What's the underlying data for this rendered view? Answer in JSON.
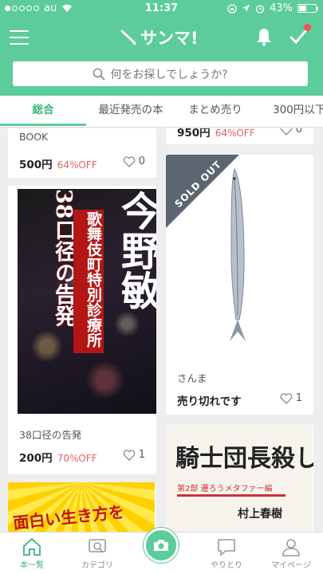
{
  "status_bar": {
    "carrier": "au",
    "time": "11:37",
    "battery": "43%",
    "battery_level": 0.43
  },
  "header": {
    "app_name": "サンマ!",
    "notification_dot": true
  },
  "search": {
    "placeholder": "何をお探しでしょうか?"
  },
  "tabs": [
    {
      "label": "総合",
      "active": true
    },
    {
      "label": "最近発売の本",
      "active": false
    },
    {
      "label": "まとめ売り",
      "active": false
    },
    {
      "label": "300円以下",
      "active": false
    }
  ],
  "items": {
    "golf": {
      "title": "女性のためのゴルフスタートBOOK",
      "price": "500円",
      "off": "64%OFF",
      "likes": "0"
    },
    "prev_right": {
      "price": "950円",
      "off": "64%OFF",
      "likes": "0"
    },
    "kon": {
      "cover_title": "38口径の告発",
      "cover_subtitle": "歌舞伎町特別診療所",
      "cover_author": "今野敏",
      "title": "38口径の告発",
      "price": "200円",
      "off": "70%OFF",
      "likes": "1"
    },
    "sanma": {
      "badge": "SOLD OUT",
      "title": "さんま",
      "status": "売り切れです",
      "likes": "1"
    },
    "kishi": {
      "cover_title": "騎士団長殺し",
      "cover_subtitle": "第2部 遷ろうメタファー編",
      "cover_author": "村上春樹"
    },
    "yellow": {
      "cover_text": "面白い生き方を"
    }
  },
  "bottom_nav": [
    {
      "label": "本一覧",
      "icon": "home-icon",
      "active": true
    },
    {
      "label": "カテゴリ",
      "icon": "category-icon",
      "active": false
    },
    {
      "label": "",
      "icon": "camera-icon",
      "active": false
    },
    {
      "label": "やりとり",
      "icon": "chat-icon",
      "active": false
    },
    {
      "label": "マイページ",
      "icon": "user-icon",
      "active": false
    }
  ],
  "colors": {
    "brand": "#5ccc9a",
    "accent_text": "#3ab37f",
    "discount": "#e06464",
    "sold_out": "#5b6670"
  }
}
